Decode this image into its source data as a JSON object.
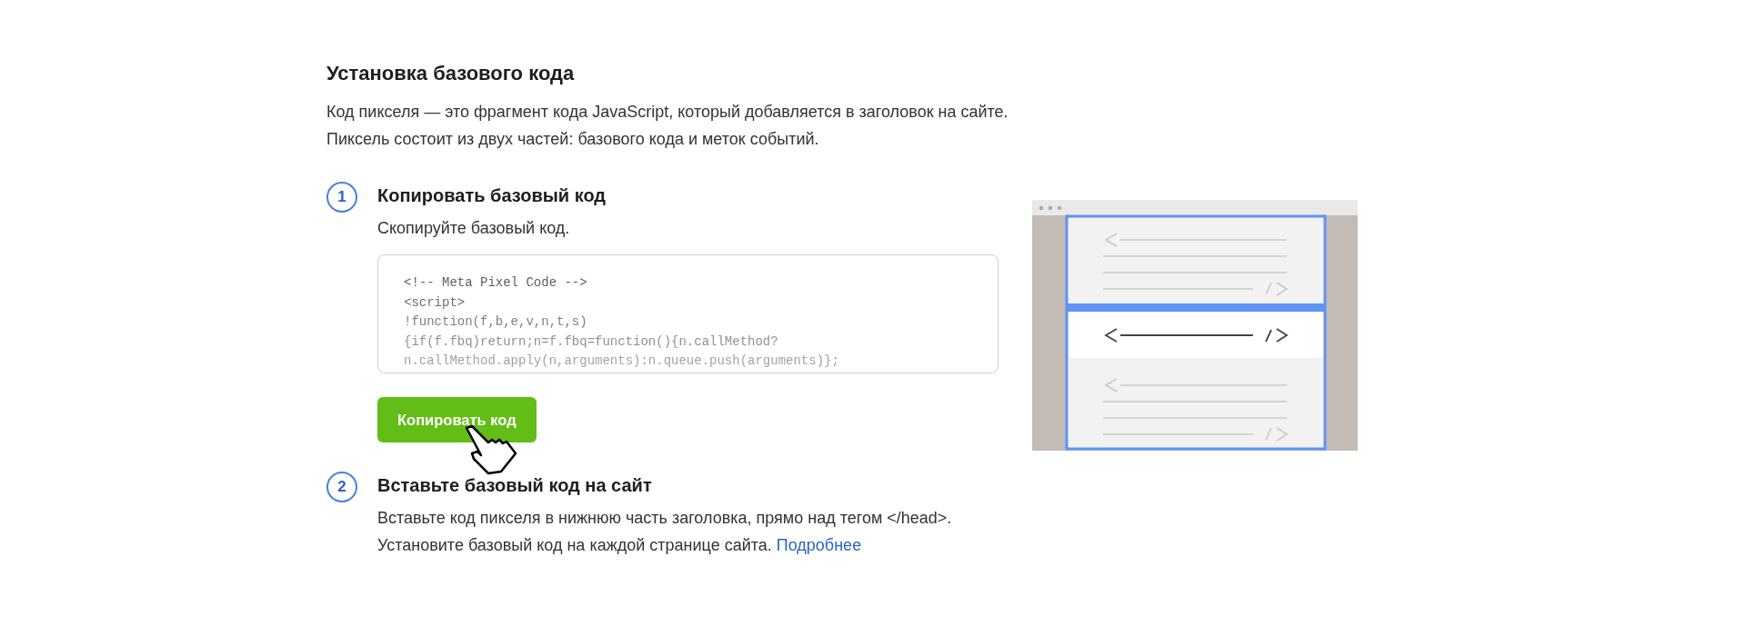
{
  "title": "Установка базового кода",
  "intro": "Код пикселя — это фрагмент кода JavaScript, который добавляется в заголовок на сайте. Пиксель состоит из двух частей: базового кода и меток событий.",
  "steps": [
    {
      "number": "1",
      "title": "Копировать базовый код",
      "description": "Скопируйте базовый код.",
      "code_lines": [
        "<!-- Meta Pixel Code -->",
        "<script>",
        "!function(f,b,e,v,n,t,s)",
        "{if(f.fbq)return;n=f.fbq=function(){n.callMethod?",
        "n.callMethod.apply(n,arguments):n.queue.push(arguments)};"
      ],
      "button": "Копировать код"
    },
    {
      "number": "2",
      "title": "Вставьте базовый код на сайт",
      "description": "Вставьте код пикселя в нижнюю часть заголовка, прямо над тегом </head>. Установите базовый код на каждой странице сайта.",
      "link": "Подробнее"
    }
  ]
}
